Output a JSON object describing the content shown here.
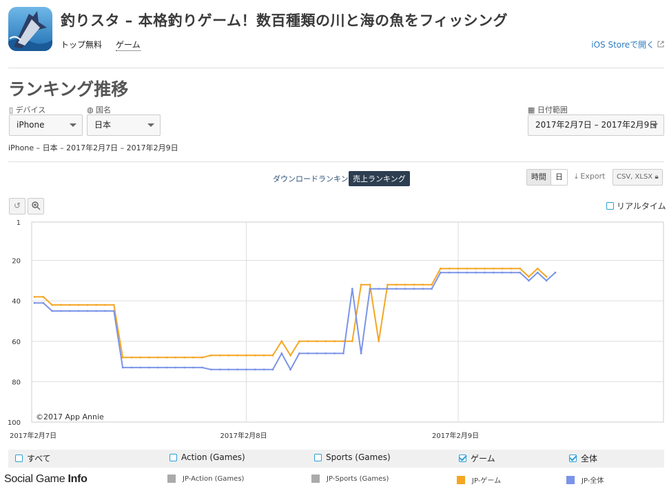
{
  "app": {
    "title": "釣りスタ – 本格釣りゲーム！数百種類の川と海の魚をフィッシング",
    "price": "トップ無料",
    "genre": "ゲーム",
    "store_link": "iOS Storeで開く"
  },
  "section_title": "ランキング推移",
  "filters": {
    "device_label": "デバイス",
    "device_value": "iPhone",
    "country_label": "国名",
    "country_value": "日本",
    "date_label": "日付範囲",
    "date_value": "2017年2月7日 – 2017年2月9日"
  },
  "subtitle": "iPhone – 日本 – 2017年2月7日 – 2017年2月9日",
  "ranking_tabs": {
    "download": "ダウンロードランキング",
    "sales": "売上ランキング"
  },
  "granularity": {
    "hour": "時間",
    "day": "日"
  },
  "export": {
    "label": "Export",
    "formats": "CSV, XLSX"
  },
  "realtime_label": "リアルタイム",
  "legend_categories": [
    {
      "label": "すべて",
      "checked": false
    },
    {
      "label": "Action (Games)",
      "checked": false
    },
    {
      "label": "Sports (Games)",
      "checked": false
    },
    {
      "label": "ゲーム",
      "checked": true
    },
    {
      "label": "全体",
      "checked": true
    }
  ],
  "series_legend": [
    {
      "label": "JP-Action (Games)",
      "color": "#aaaaaa"
    },
    {
      "label": "JP-Sports (Games)",
      "color": "#aaaaaa"
    },
    {
      "label": "JP-ゲーム",
      "color": "#f5a623"
    },
    {
      "label": "JP-全体",
      "color": "#7b93e8"
    }
  ],
  "watermark": {
    "part1": "Social Game ",
    "part2": "Info"
  },
  "chart_data": {
    "type": "line",
    "credit": "©2017 App Annie",
    "y_inverted": true,
    "ylim": [
      1,
      100
    ],
    "yticks": [
      1,
      20,
      40,
      60,
      80,
      100
    ],
    "x_start": "2017-02-07 00:00",
    "x_end": "2017-02-09 12:00",
    "xtick_labels": [
      "2017年2月7日",
      "2017年2月8日",
      "2017年2月9日"
    ],
    "grid": true,
    "series": [
      {
        "name": "JP-ゲーム",
        "color": "#f5a623",
        "points": [
          [
            "2017-02-07 00:00",
            38
          ],
          [
            "2017-02-07 01:00",
            38
          ],
          [
            "2017-02-07 02:00",
            42
          ],
          [
            "2017-02-07 03:00",
            42
          ],
          [
            "2017-02-07 04:00",
            42
          ],
          [
            "2017-02-07 05:00",
            42
          ],
          [
            "2017-02-07 06:00",
            42
          ],
          [
            "2017-02-07 07:00",
            42
          ],
          [
            "2017-02-07 08:00",
            42
          ],
          [
            "2017-02-07 09:00",
            42
          ],
          [
            "2017-02-07 10:00",
            68
          ],
          [
            "2017-02-07 11:00",
            68
          ],
          [
            "2017-02-07 12:00",
            68
          ],
          [
            "2017-02-07 13:00",
            68
          ],
          [
            "2017-02-07 14:00",
            68
          ],
          [
            "2017-02-07 15:00",
            68
          ],
          [
            "2017-02-07 16:00",
            68
          ],
          [
            "2017-02-07 17:00",
            68
          ],
          [
            "2017-02-07 18:00",
            68
          ],
          [
            "2017-02-07 19:00",
            68
          ],
          [
            "2017-02-07 20:00",
            67
          ],
          [
            "2017-02-07 21:00",
            67
          ],
          [
            "2017-02-07 22:00",
            67
          ],
          [
            "2017-02-07 23:00",
            67
          ],
          [
            "2017-02-08 00:00",
            67
          ],
          [
            "2017-02-08 01:00",
            67
          ],
          [
            "2017-02-08 02:00",
            67
          ],
          [
            "2017-02-08 03:00",
            67
          ],
          [
            "2017-02-08 04:00",
            60
          ],
          [
            "2017-02-08 05:00",
            67
          ],
          [
            "2017-02-08 06:00",
            60
          ],
          [
            "2017-02-08 07:00",
            60
          ],
          [
            "2017-02-08 08:00",
            60
          ],
          [
            "2017-02-08 09:00",
            60
          ],
          [
            "2017-02-08 10:00",
            60
          ],
          [
            "2017-02-08 11:00",
            60
          ],
          [
            "2017-02-08 12:00",
            60
          ],
          [
            "2017-02-08 13:00",
            32
          ],
          [
            "2017-02-08 14:00",
            32
          ],
          [
            "2017-02-08 15:00",
            60
          ],
          [
            "2017-02-08 16:00",
            32
          ],
          [
            "2017-02-08 17:00",
            32
          ],
          [
            "2017-02-08 18:00",
            32
          ],
          [
            "2017-02-08 19:00",
            32
          ],
          [
            "2017-02-08 20:00",
            32
          ],
          [
            "2017-02-08 21:00",
            32
          ],
          [
            "2017-02-08 22:00",
            24
          ],
          [
            "2017-02-08 23:00",
            24
          ],
          [
            "2017-02-09 00:00",
            24
          ],
          [
            "2017-02-09 01:00",
            24
          ],
          [
            "2017-02-09 02:00",
            24
          ],
          [
            "2017-02-09 03:00",
            24
          ],
          [
            "2017-02-09 04:00",
            24
          ],
          [
            "2017-02-09 05:00",
            24
          ],
          [
            "2017-02-09 06:00",
            24
          ],
          [
            "2017-02-09 07:00",
            24
          ],
          [
            "2017-02-09 08:00",
            28
          ],
          [
            "2017-02-09 09:00",
            24
          ],
          [
            "2017-02-09 10:00",
            28
          ]
        ]
      },
      {
        "name": "JP-全体",
        "color": "#7b93e8",
        "points": [
          [
            "2017-02-07 00:00",
            41
          ],
          [
            "2017-02-07 01:00",
            41
          ],
          [
            "2017-02-07 02:00",
            45
          ],
          [
            "2017-02-07 03:00",
            45
          ],
          [
            "2017-02-07 04:00",
            45
          ],
          [
            "2017-02-07 05:00",
            45
          ],
          [
            "2017-02-07 06:00",
            45
          ],
          [
            "2017-02-07 07:00",
            45
          ],
          [
            "2017-02-07 08:00",
            45
          ],
          [
            "2017-02-07 09:00",
            45
          ],
          [
            "2017-02-07 10:00",
            73
          ],
          [
            "2017-02-07 11:00",
            73
          ],
          [
            "2017-02-07 12:00",
            73
          ],
          [
            "2017-02-07 13:00",
            73
          ],
          [
            "2017-02-07 14:00",
            73
          ],
          [
            "2017-02-07 15:00",
            73
          ],
          [
            "2017-02-07 16:00",
            73
          ],
          [
            "2017-02-07 17:00",
            73
          ],
          [
            "2017-02-07 18:00",
            73
          ],
          [
            "2017-02-07 19:00",
            73
          ],
          [
            "2017-02-07 20:00",
            74
          ],
          [
            "2017-02-07 21:00",
            74
          ],
          [
            "2017-02-07 22:00",
            74
          ],
          [
            "2017-02-07 23:00",
            74
          ],
          [
            "2017-02-08 00:00",
            74
          ],
          [
            "2017-02-08 01:00",
            74
          ],
          [
            "2017-02-08 02:00",
            74
          ],
          [
            "2017-02-08 03:00",
            74
          ],
          [
            "2017-02-08 04:00",
            66
          ],
          [
            "2017-02-08 05:00",
            74
          ],
          [
            "2017-02-08 06:00",
            66
          ],
          [
            "2017-02-08 07:00",
            66
          ],
          [
            "2017-02-08 08:00",
            66
          ],
          [
            "2017-02-08 09:00",
            66
          ],
          [
            "2017-02-08 10:00",
            66
          ],
          [
            "2017-02-08 11:00",
            66
          ],
          [
            "2017-02-08 12:00",
            34
          ],
          [
            "2017-02-08 13:00",
            66
          ],
          [
            "2017-02-08 14:00",
            34
          ],
          [
            "2017-02-08 15:00",
            34
          ],
          [
            "2017-02-08 16:00",
            34
          ],
          [
            "2017-02-08 17:00",
            34
          ],
          [
            "2017-02-08 18:00",
            34
          ],
          [
            "2017-02-08 19:00",
            34
          ],
          [
            "2017-02-08 20:00",
            34
          ],
          [
            "2017-02-08 21:00",
            34
          ],
          [
            "2017-02-08 22:00",
            26
          ],
          [
            "2017-02-08 23:00",
            26
          ],
          [
            "2017-02-09 00:00",
            26
          ],
          [
            "2017-02-09 01:00",
            26
          ],
          [
            "2017-02-09 02:00",
            26
          ],
          [
            "2017-02-09 03:00",
            26
          ],
          [
            "2017-02-09 04:00",
            26
          ],
          [
            "2017-02-09 05:00",
            26
          ],
          [
            "2017-02-09 06:00",
            26
          ],
          [
            "2017-02-09 07:00",
            26
          ],
          [
            "2017-02-09 08:00",
            30
          ],
          [
            "2017-02-09 09:00",
            26
          ],
          [
            "2017-02-09 10:00",
            30
          ],
          [
            "2017-02-09 11:00",
            26
          ]
        ]
      }
    ]
  }
}
